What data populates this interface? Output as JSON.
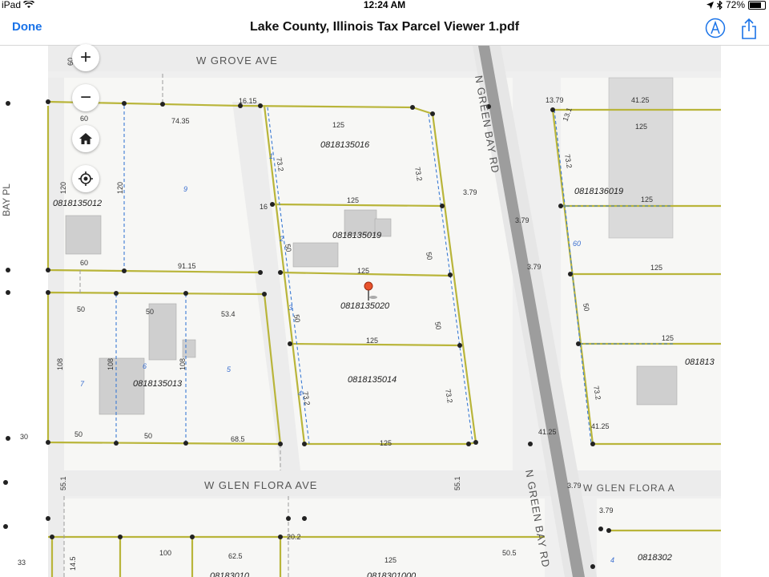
{
  "status_bar": {
    "device": "iPad",
    "time": "12:24 AM",
    "battery": "72%"
  },
  "nav": {
    "done_label": "Done",
    "title": "Lake County, Illinois Tax Parcel Viewer 1.pdf",
    "markup_icon": "markup-pen-icon",
    "share_icon": "share-icon"
  },
  "map_controls": {
    "zoom_in": "+",
    "zoom_out": "−",
    "home_icon": "home-icon",
    "locate_icon": "locate-icon"
  },
  "streets": {
    "grove": "W GROVE AVE",
    "glen_flora": "W GLEN FLORA AVE",
    "glen_flora_right": "W GLEN FLORA A",
    "green_bay_upper": "N GREEN BAY RD",
    "green_bay_lower": "N GREEN BAY RD",
    "bay_pl": "BAY PL"
  },
  "parcels": {
    "p1": "0818135012",
    "p2": "0818135016",
    "p3": "0818135019",
    "p4": "0818135020",
    "p5": "0818135014",
    "p6": "0818135013",
    "p7": "0818136019",
    "p8": "081813",
    "p9": "0818302",
    "p10": "08183010",
    "p11": "0818301000"
  },
  "dimensions": {
    "d60a": "60",
    "d60b": "60",
    "d7435": "74.35",
    "d120a": "120",
    "d120b": "120",
    "d6015": "60",
    "d9115": "91.15",
    "d1615": "16.15",
    "d125a": "125",
    "d732a": "73.2",
    "d732b": "73.2",
    "d16": "16",
    "d125b": "125",
    "d50a": "50",
    "d50b": "50",
    "d125c": "125",
    "d50c": "50",
    "d50d": "50",
    "d534": "53.4",
    "d50e": "50",
    "d108a": "108",
    "d108b": "108",
    "d108c": "108",
    "d125d": "125",
    "d732c": "73.2",
    "d732d": "73.2",
    "d30": "30",
    "d50f": "50",
    "d50g": "50",
    "d685": "68.5",
    "d125e": "125",
    "d379a": "3.79",
    "d379b": "3.79",
    "d379c": "3.79",
    "d4125a": "41.25",
    "d1379": "13.79",
    "d4125b": "41.25",
    "d131": "13.1",
    "d125f": "125",
    "d732e": "73.2",
    "d125g": "125",
    "d50h": "50",
    "d125h": "125",
    "d125i": "125",
    "d732f": "73.2",
    "d4125c": "41.25",
    "d551a": "55.1",
    "d551b": "55.1",
    "d379d": "3.79",
    "d379e": "3.79",
    "d202": "20.2",
    "d33": "33",
    "d145": "14.5",
    "d100": "100",
    "d625": "62.5",
    "d125j": "125",
    "d505": "50.5"
  },
  "lots": {
    "l8": "8",
    "l9": "9",
    "l1": "1",
    "l2": "2",
    "l3": "3",
    "l4": "4",
    "l5": "5",
    "l6": "6",
    "l7": "7",
    "l60": "60",
    "l4r": "4"
  }
}
